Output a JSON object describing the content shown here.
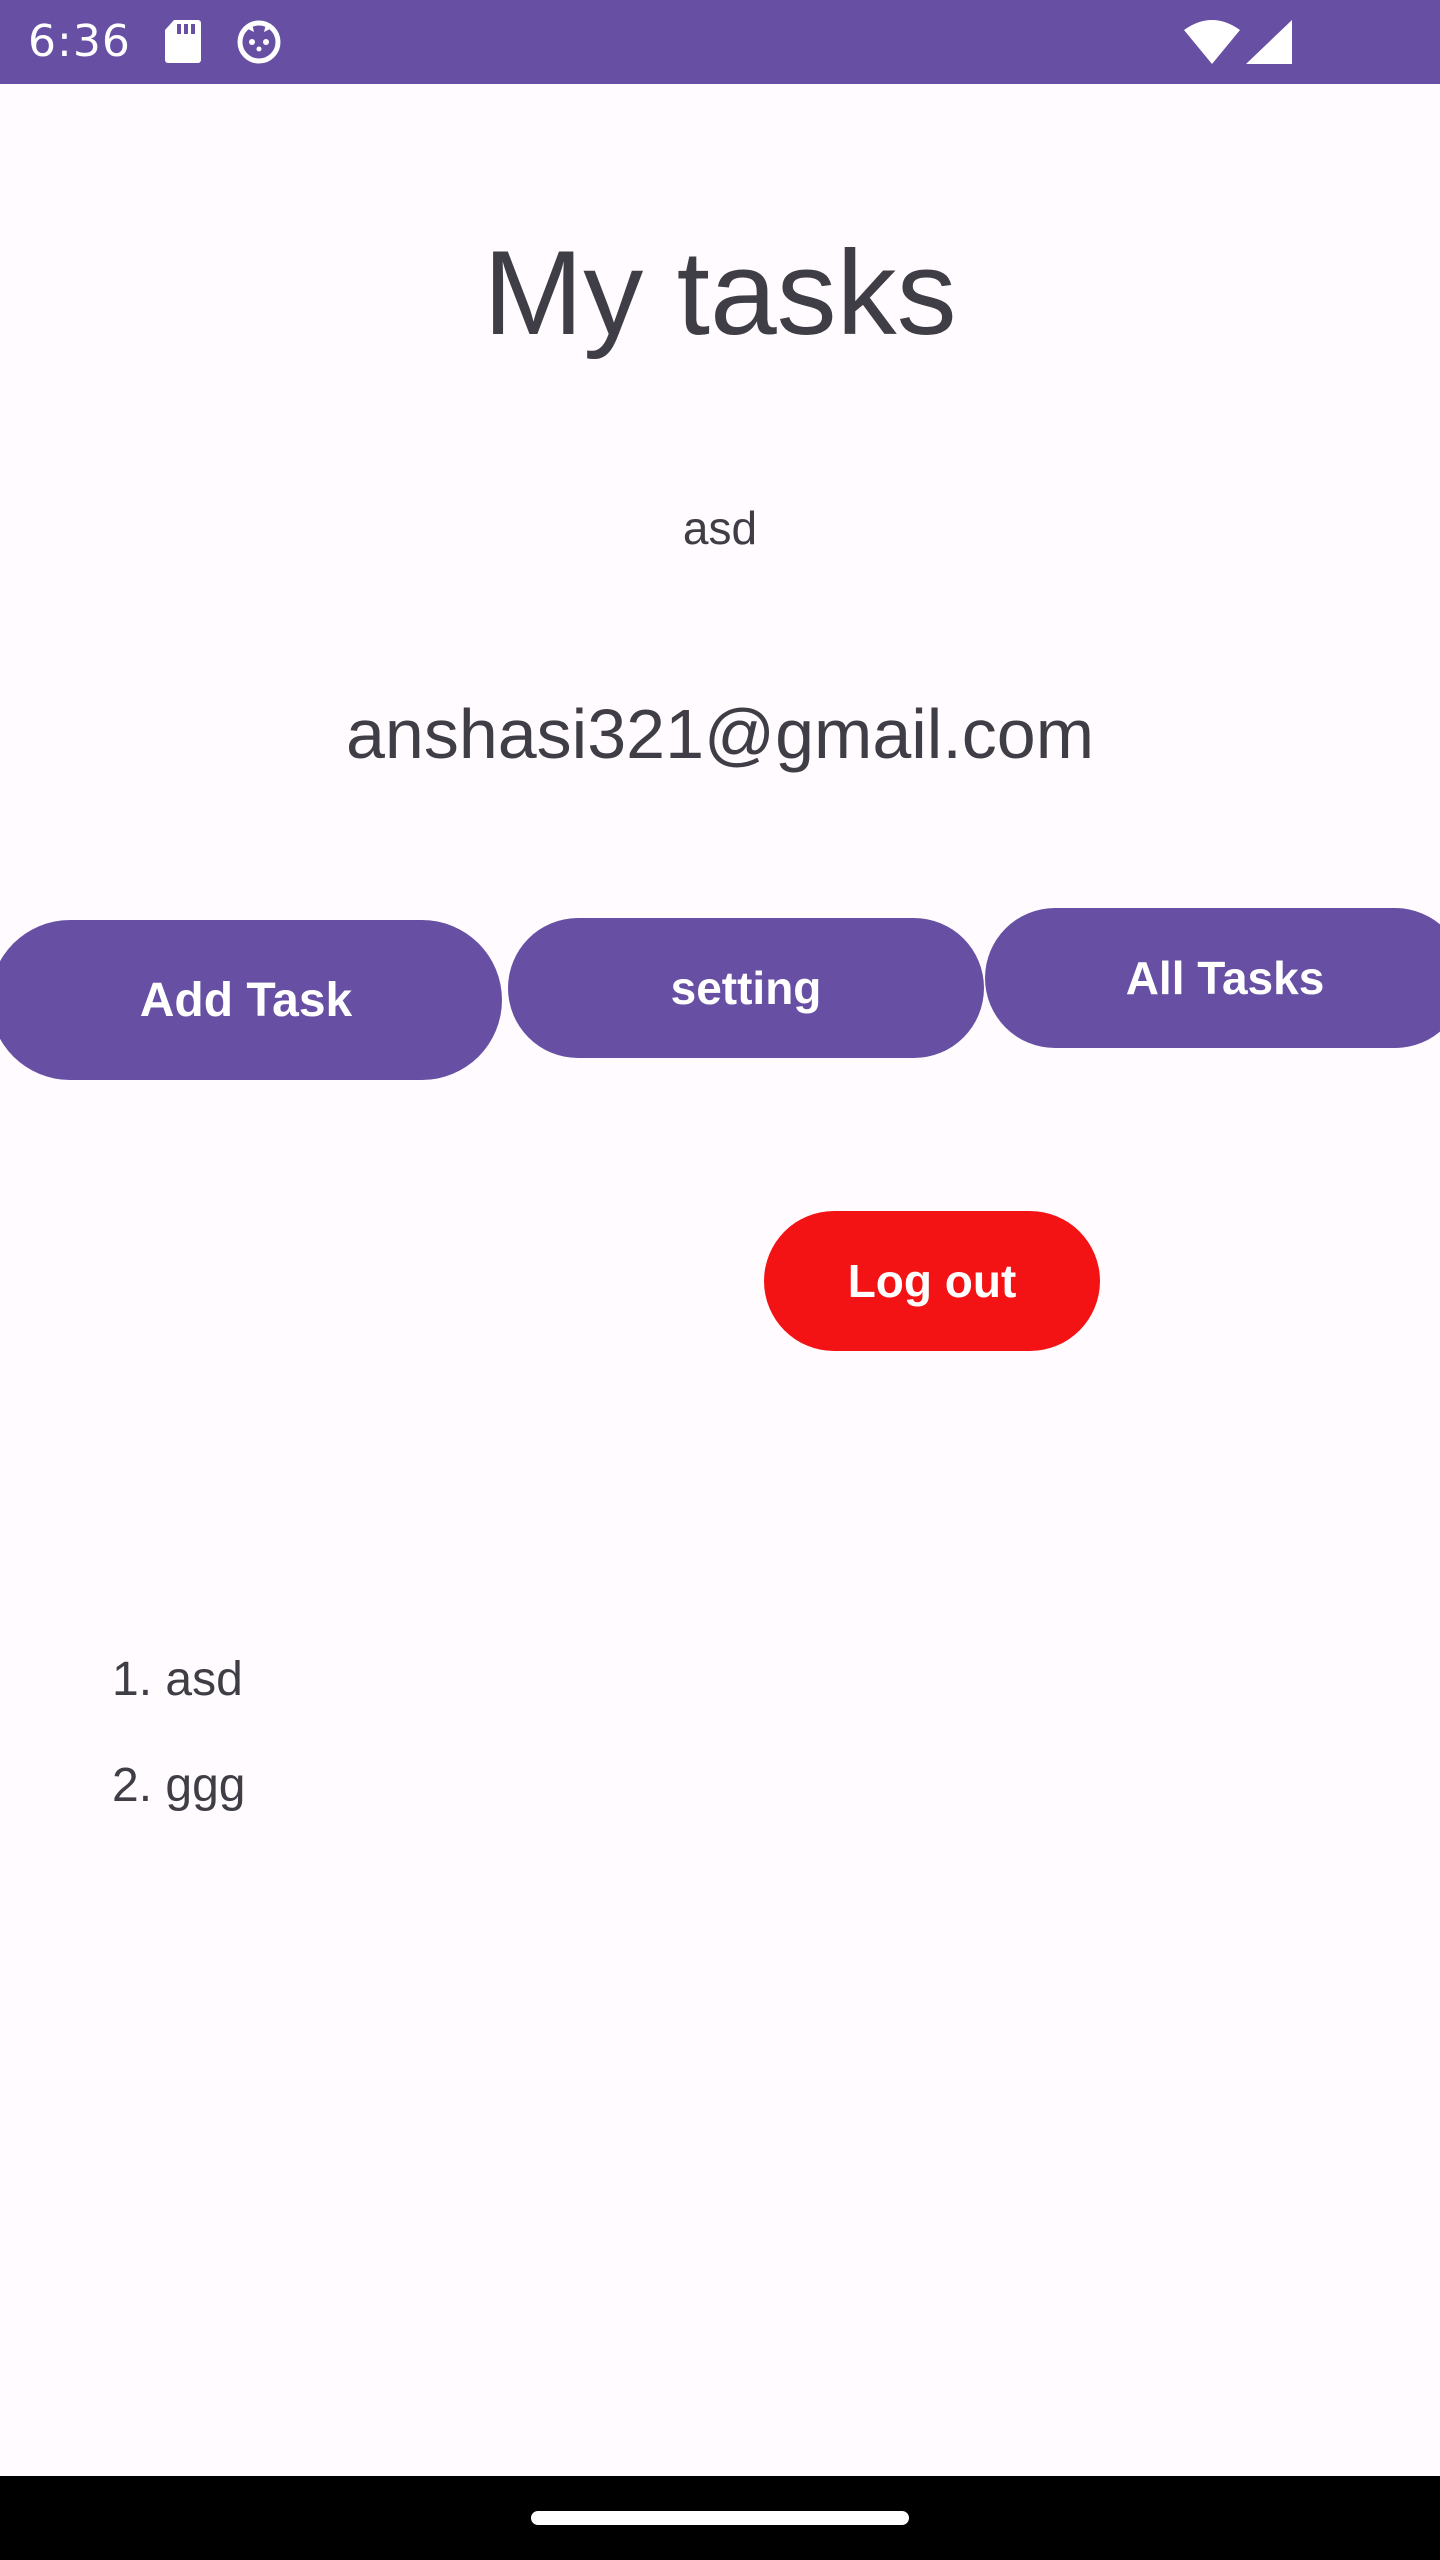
{
  "status_bar": {
    "time": "6:36",
    "background": "#6750a4",
    "icons": [
      "sd-card-icon",
      "cat-face-icon",
      "wifi-icon",
      "signal-icon"
    ]
  },
  "header": {
    "title": "My tasks"
  },
  "user": {
    "name": "asd",
    "email": "anshasi321@gmail.com"
  },
  "actions": {
    "add_task_label": "Add Task",
    "setting_label": "setting",
    "all_tasks_label": "All Tasks",
    "logout_label": "Log out",
    "primary_color": "#6750a4",
    "logout_color": "#f41314"
  },
  "tasks": [
    {
      "label": "1. asd"
    },
    {
      "label": "2. ggg"
    }
  ]
}
